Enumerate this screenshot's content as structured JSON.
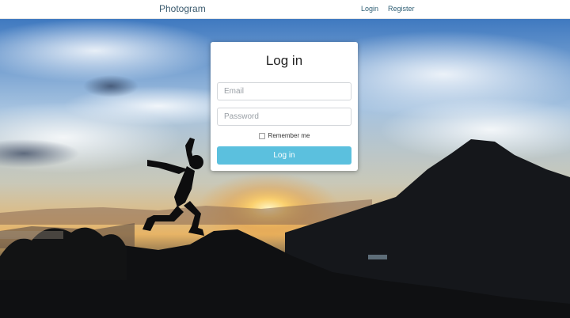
{
  "navbar": {
    "brand": "Photogram",
    "links": [
      {
        "label": "Login"
      },
      {
        "label": "Register"
      }
    ]
  },
  "login_card": {
    "title": "Log in",
    "email_placeholder": "Email",
    "password_placeholder": "Password",
    "remember_label": "Remember me",
    "submit_label": "Log in"
  },
  "colors": {
    "primary_button": "#5bc0de",
    "nav_link": "#2f5f75"
  }
}
